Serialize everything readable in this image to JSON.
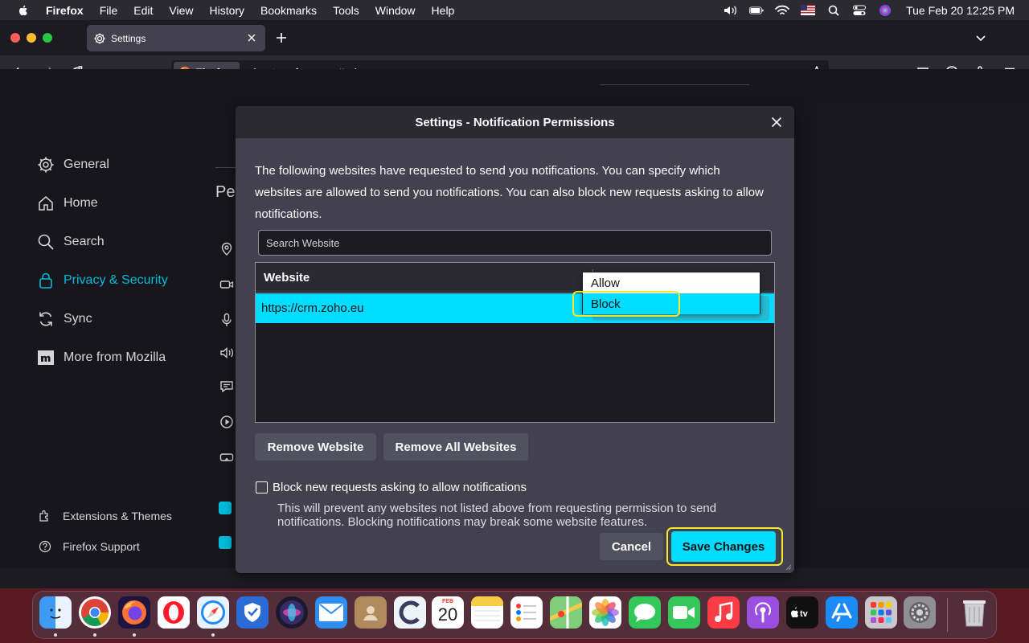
{
  "menubar": {
    "app": "Firefox",
    "items": [
      "File",
      "Edit",
      "View",
      "History",
      "Bookmarks",
      "Tools",
      "Window",
      "Help"
    ],
    "clock": "Tue Feb 20  12:25 PM"
  },
  "tab": {
    "title": "Settings"
  },
  "urlbar": {
    "identity": "Firefox",
    "url": "about:preferences#privacy"
  },
  "sidebar": {
    "items": [
      {
        "label": "General"
      },
      {
        "label": "Home"
      },
      {
        "label": "Search"
      },
      {
        "label": "Privacy & Security"
      },
      {
        "label": "Sync"
      },
      {
        "label": "More from Mozilla"
      }
    ],
    "footer": [
      {
        "label": "Extensions & Themes"
      },
      {
        "label": "Firefox Support"
      }
    ]
  },
  "background": {
    "section_title_partial": "Pe"
  },
  "dialog": {
    "title": "Settings - Notification Permissions",
    "description": "The following websites have requested to send you notifications. You can specify which websites are allowed to send you notifications. You can also block new requests asking to allow notifications.",
    "search_placeholder": "Search Website",
    "table": {
      "header_website": "Website",
      "rows": [
        {
          "website": "https://crm.zoho.eu"
        }
      ]
    },
    "dropdown": {
      "options": [
        "Allow",
        "Block"
      ],
      "highlighted": "Block"
    },
    "remove_label": "Remove Website",
    "remove_all_label": "Remove All Websites",
    "block_checkbox_label": "Block new requests asking to allow notifications",
    "block_checkbox_checked": false,
    "block_description": "This will prevent any websites not listed above from requesting permission to send notifications. Blocking notifications may break some website features.",
    "cancel_label": "Cancel",
    "save_label": "Save Changes"
  },
  "calendar": {
    "month": "FEB",
    "day": "20"
  },
  "colors": {
    "accent": "#00ddff",
    "dialog_bg": "#42414d",
    "page_bg": "#1c1b22",
    "highlight_outline": "#f3e82d"
  }
}
